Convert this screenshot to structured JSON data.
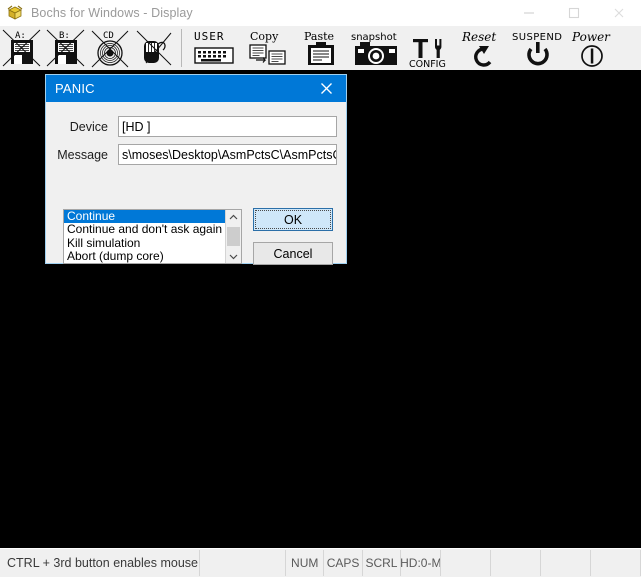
{
  "window": {
    "title": "Bochs for Windows - Display",
    "icon": "bochs-logo-icon",
    "controls": {
      "minimize": "minimize-icon",
      "maximize": "maximize-icon",
      "close": "close-icon"
    }
  },
  "toolbar": {
    "items": [
      {
        "id": "floppy-a",
        "label": "A:",
        "icon": "floppy-disk-a-icon"
      },
      {
        "id": "floppy-b",
        "label": "B:",
        "icon": "floppy-disk-b-icon"
      },
      {
        "id": "cdrom",
        "label": "CD",
        "icon": "cdrom-icon"
      },
      {
        "id": "mouse",
        "label": "",
        "icon": "mouse-icon"
      },
      {
        "id": "user",
        "label": "USER",
        "icon": "keyboard-icon"
      },
      {
        "id": "copy",
        "label": "Copy",
        "icon": "copy-icon"
      },
      {
        "id": "paste",
        "label": "Paste",
        "icon": "paste-icon"
      },
      {
        "id": "snapshot",
        "label": "snapshot",
        "icon": "camera-icon"
      },
      {
        "id": "config",
        "label": "CONFIG",
        "icon": "tools-icon"
      },
      {
        "id": "reset",
        "label": "Reset",
        "icon": "reset-arrow-icon"
      },
      {
        "id": "suspend",
        "label": "SUSPEND",
        "icon": "suspend-power-icon"
      },
      {
        "id": "power",
        "label": "Power",
        "icon": "power-icon"
      }
    ]
  },
  "dialog": {
    "title": "PANIC",
    "close_label": "✕",
    "fields": {
      "device_label": "Device",
      "device_value": "[HD   ]",
      "message_label": "Message",
      "message_value": "s\\moses\\Desktop\\AsmPctsC\\AsmPctsC.vhd'"
    },
    "options": [
      "Continue",
      "Continue and don't ask again",
      "Kill simulation",
      "Abort (dump core)"
    ],
    "selected_option_index": 0,
    "scroll_up_glyph": "∧",
    "scroll_down_glyph": "∨",
    "ok_label": "OK",
    "cancel_label": "Cancel",
    "accent_color": "#0078d7"
  },
  "statusbar": {
    "message": "CTRL + 3rd button enables mouse",
    "blank_cell": "",
    "indicators": [
      {
        "id": "num",
        "label": "NUM"
      },
      {
        "id": "caps",
        "label": "CAPS"
      },
      {
        "id": "scrl",
        "label": "SCRL"
      },
      {
        "id": "hd",
        "label": "HD:0-M"
      }
    ],
    "empty_cells": [
      "",
      "",
      "",
      ""
    ]
  }
}
